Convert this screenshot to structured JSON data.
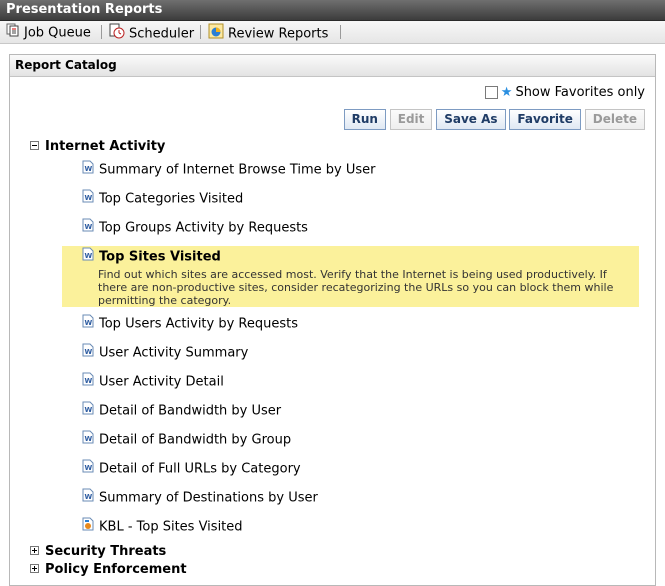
{
  "window": {
    "title": "Presentation Reports"
  },
  "toolbar": {
    "job_queue": "Job Queue",
    "scheduler": "Scheduler",
    "review_reports": "Review Reports"
  },
  "catalog": {
    "title": "Report Catalog",
    "favorites_label": "Show Favorites only",
    "favorites_checked": false,
    "buttons": {
      "run": "Run",
      "edit": "Edit",
      "save_as": "Save As",
      "favorite": "Favorite",
      "delete": "Delete"
    },
    "groups": {
      "internet_activity": "Internet Activity",
      "security_threats": "Security Threats",
      "policy_enforcement": "Policy Enforcement"
    },
    "reports": [
      "Summary of Internet Browse Time by User",
      "Top Categories Visited",
      "Top Groups Activity by Requests",
      "Top Sites Visited",
      "Top Users Activity by Requests",
      "User Activity Summary",
      "User Activity Detail",
      "Detail of Bandwidth by User",
      "Detail of Bandwidth by Group",
      "Detail of Full URLs by Category",
      "Summary of Destinations by User",
      "KBL - Top Sites Visited"
    ],
    "selected_description": "Find out which sites are accessed most. Verify that the Internet is being used productively. If there are non-productive sites, consider recategorizing the URLs so you can block them while permitting the category."
  },
  "colors": {
    "highlight": "#fbf19b",
    "button_text": "#1f3c66",
    "star": "#2a8fe0"
  }
}
